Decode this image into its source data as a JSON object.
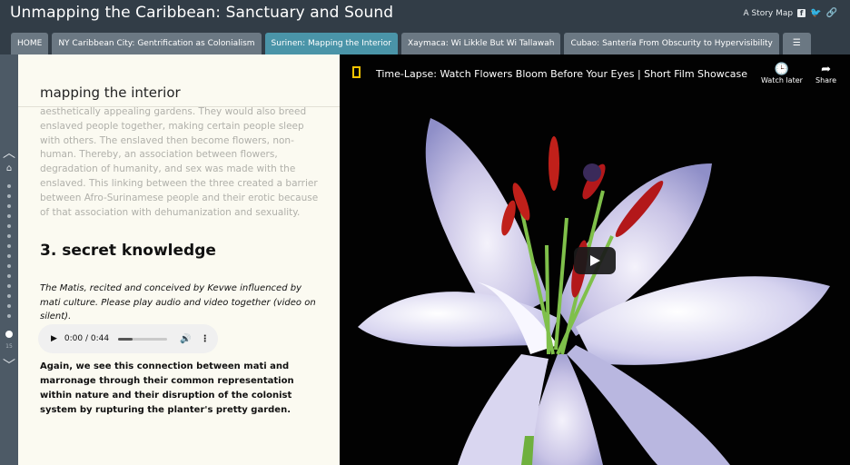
{
  "header": {
    "title": "Unmapping the Caribbean: Sanctuary and Sound",
    "brand": "A Story Map"
  },
  "tabs": [
    {
      "label": "HOME",
      "active": false
    },
    {
      "label": "NY Caribbean City: Gentrification as Colonialism",
      "active": false
    },
    {
      "label": "Surinen: Mapping the Interior",
      "active": true
    },
    {
      "label": "Xaymaca: Wi Likkle But Wi Tallawah",
      "active": false
    },
    {
      "label": "Cubao: Santería From Obscurity to Hypervisibility",
      "active": false
    }
  ],
  "rail": {
    "current_index": "15"
  },
  "panel": {
    "section_heading": "mapping the interior",
    "faded_text": "aesthetically appealing gardens. They would also breed enslaved people together, making certain people sleep with others. The enslaved then become flowers, non-human. Thereby, an association between flowers, degradation of humanity, and sex was made with the enslaved. This linking between the three created a barrier between Afro-Surinamese people and their erotic because of that association with dehumanization and sexuality.",
    "heading": "3. secret knowledge",
    "italic_note": "The Matis, recited and conceived by Kevwe influenced by mati culture. Please play audio and video together (video on silent).",
    "audio": {
      "time": "0:00 / 0:44",
      "progress": 0.3
    },
    "bold_text": "Again, we see this connection between mati and marronage through their common representation within nature and their disruption of the colonist system by rupturing the planter's pretty garden."
  },
  "video": {
    "title": "Time-Lapse: Watch Flowers Bloom Before Your Eyes | Short Film Showcase",
    "watch_later": "Watch later",
    "share": "Share"
  },
  "colors": {
    "header_bg": "#323d47",
    "tab_bg": "#6b7883",
    "tab_active_bg": "#4a94a8",
    "panel_bg": "#fbfaf1"
  }
}
